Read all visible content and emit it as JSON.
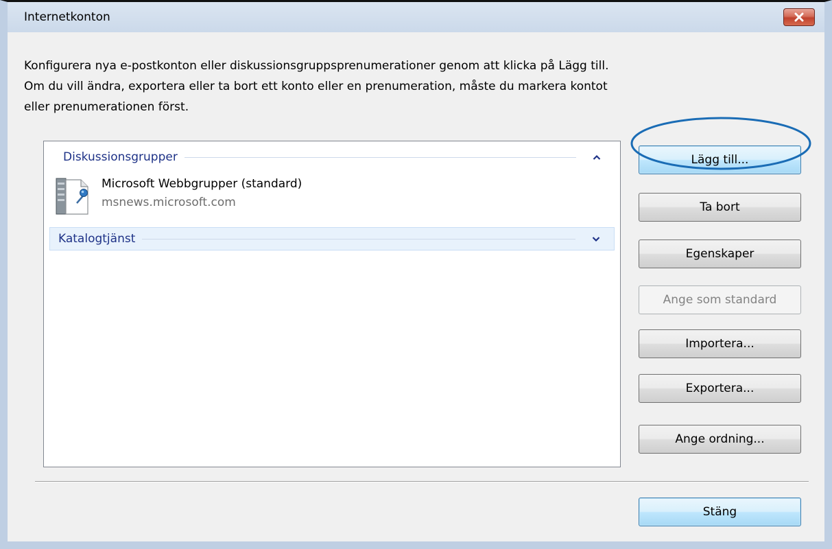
{
  "window": {
    "title": "Internetkonton"
  },
  "intro": {
    "line1": "Konfigurera nya e-postkonton eller diskussionsgruppsprenumerationer genom att klicka på Lägg till.",
    "line2": "Om du vill ändra, exportera eller ta bort ett konto eller en prenumeration, måste du markera kontot eller prenumerationen först."
  },
  "list": {
    "groups": [
      {
        "label": "Diskussionsgrupper",
        "expanded": true,
        "items": [
          {
            "name": "Microsoft Webbgrupper (standard)",
            "server": "msnews.microsoft.com",
            "icon": "news-server-icon"
          }
        ]
      },
      {
        "label": "Katalogtjänst",
        "expanded": false,
        "items": []
      }
    ]
  },
  "buttons": {
    "add": "Lägg till...",
    "remove": "Ta bort",
    "properties": "Egenskaper",
    "set_default": "Ange som standard",
    "import": "Importera...",
    "export": "Exportera...",
    "set_order": "Ange ordning...",
    "close": "Stäng"
  },
  "colors": {
    "group_header_text": "#1e3287",
    "highlight_ring": "#1a6cb5",
    "close_button": "#c7503e"
  }
}
